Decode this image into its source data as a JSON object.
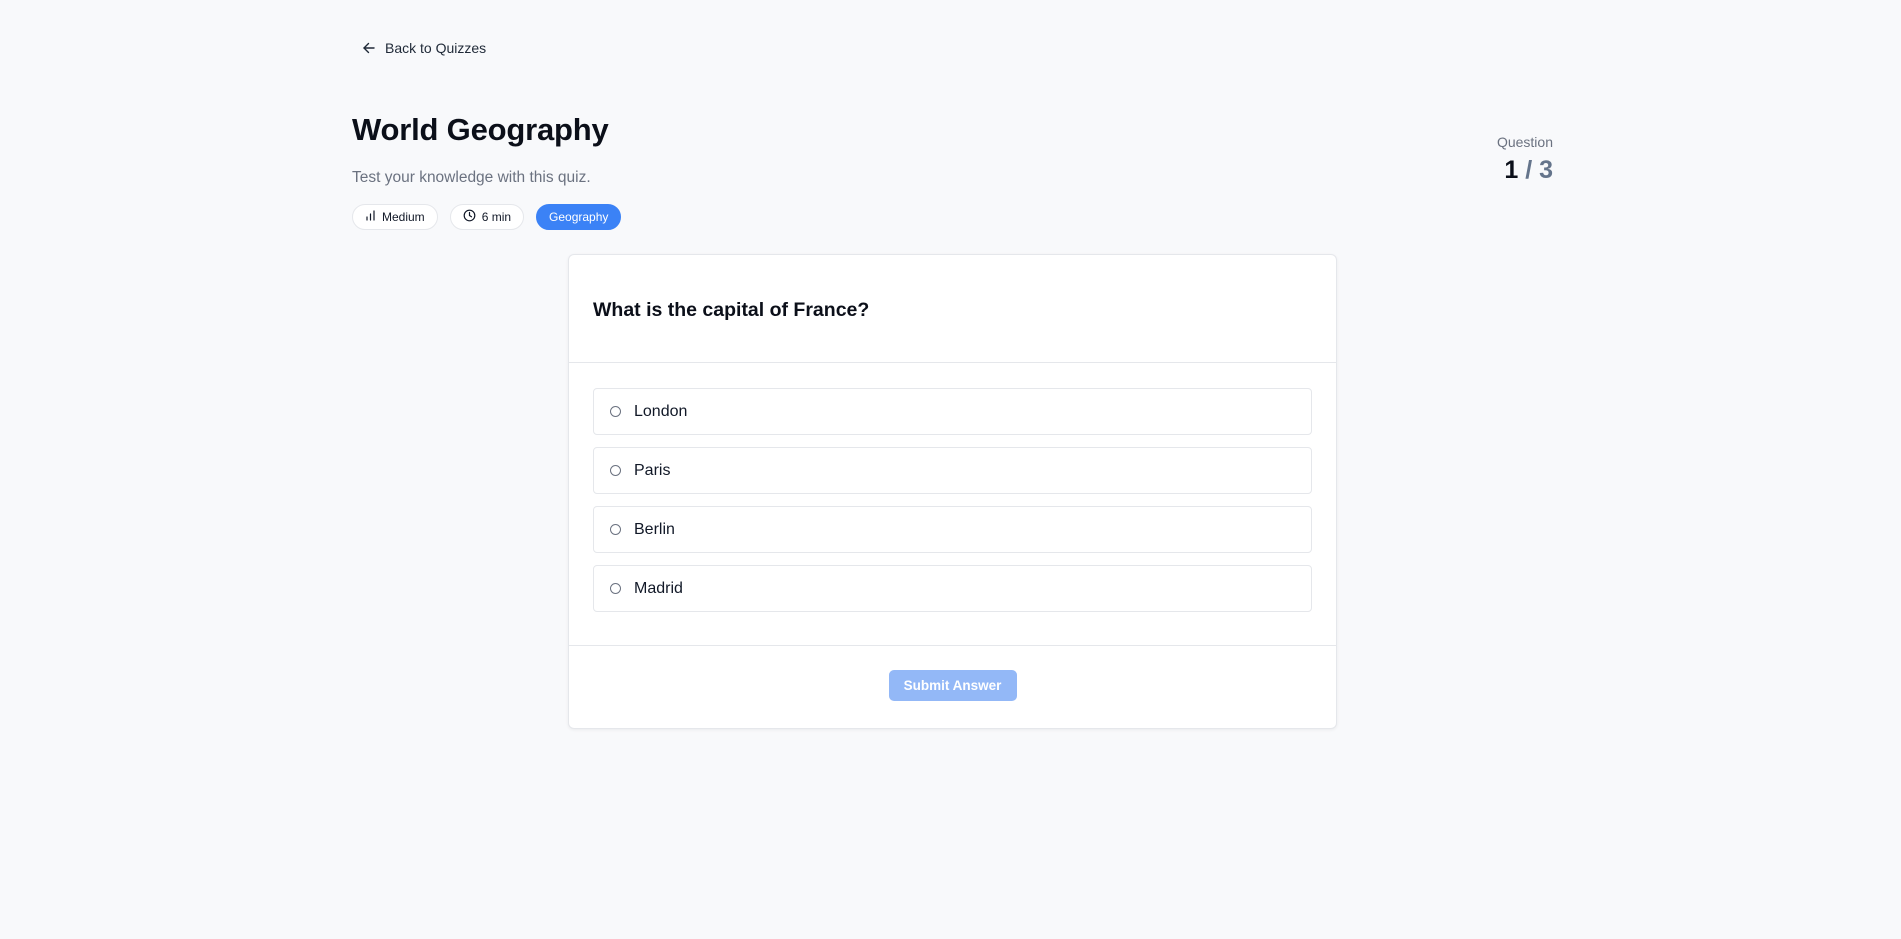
{
  "nav": {
    "back_label": "Back to Quizzes",
    "back_icon": "arrow-left-icon"
  },
  "quiz": {
    "title": "World Geography",
    "subtitle": "Test your knowledge with this quiz.",
    "tags": {
      "difficulty": {
        "icon": "bar-chart-icon",
        "label": "Medium"
      },
      "duration": {
        "icon": "clock-icon",
        "label": "6 min"
      },
      "category": {
        "label": "Geography"
      }
    }
  },
  "progress": {
    "label": "Question",
    "current": "1",
    "separator": "/",
    "total": "3"
  },
  "question": {
    "text": "What is the capital of France?",
    "options": [
      {
        "label": "London",
        "selected": false
      },
      {
        "label": "Paris",
        "selected": false
      },
      {
        "label": "Berlin",
        "selected": false
      },
      {
        "label": "Madrid",
        "selected": false
      }
    ]
  },
  "actions": {
    "submit_label": "Submit Answer",
    "submit_disabled": true
  },
  "colors": {
    "accent": "#3b82f6",
    "submit_disabled_bg": "#93b8f7",
    "background": "#f8f9fb"
  }
}
